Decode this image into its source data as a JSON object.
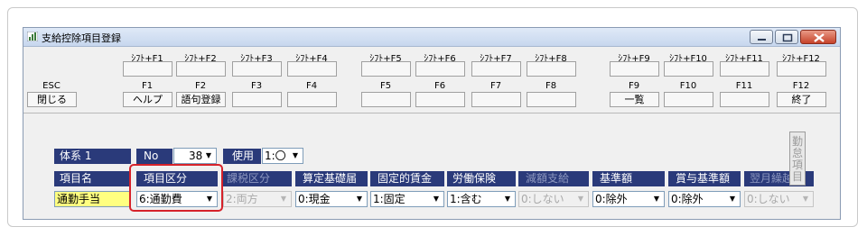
{
  "window": {
    "title": "支給控除項目登録",
    "icon": "bar-chart-icon",
    "controls": [
      "minimize-icon",
      "maximize-icon",
      "close-icon"
    ]
  },
  "fkeys": [
    {
      "shift": "",
      "key": "ESC",
      "label": "閉じる"
    },
    {
      "shift": "ｼﾌﾄ+F1",
      "key": "F1",
      "label": "ヘルプ"
    },
    {
      "shift": "ｼﾌﾄ+F2",
      "key": "F2",
      "label": "語句登録"
    },
    {
      "shift": "ｼﾌﾄ+F3",
      "key": "F3",
      "label": ""
    },
    {
      "shift": "ｼﾌﾄ+F4",
      "key": "F4",
      "label": ""
    },
    {
      "shift": "ｼﾌﾄ+F5",
      "key": "F5",
      "label": ""
    },
    {
      "shift": "ｼﾌﾄ+F6",
      "key": "F6",
      "label": ""
    },
    {
      "shift": "ｼﾌﾄ+F7",
      "key": "F7",
      "label": ""
    },
    {
      "shift": "ｼﾌﾄ+F8",
      "key": "F8",
      "label": ""
    },
    {
      "shift": "ｼﾌﾄ+F9",
      "key": "F9",
      "label": "一覧"
    },
    {
      "shift": "ｼﾌﾄ+F10",
      "key": "F10",
      "label": ""
    },
    {
      "shift": "ｼﾌﾄ+F11",
      "key": "F11",
      "label": ""
    },
    {
      "shift": "ｼﾌﾄ+F12",
      "key": "F12",
      "label": "終了"
    }
  ],
  "form": {
    "taikei_label": "体系 1",
    "no_label": "No",
    "no_value": "38",
    "shiyou_label": "使用",
    "shiyou_value": "1:〇",
    "side_label": "勤怠項目"
  },
  "columns": [
    {
      "header": "項目名",
      "value": "通勤手当",
      "enabled": true
    },
    {
      "header": "項目区分",
      "value": "6:通勤費",
      "enabled": true
    },
    {
      "header": "課税区分",
      "value": "2:両方",
      "enabled": false
    },
    {
      "header": "算定基礎届",
      "value": "0:現金",
      "enabled": true
    },
    {
      "header": "固定的賃金",
      "value": "1:固定",
      "enabled": true
    },
    {
      "header": "労働保険",
      "value": "1:含む",
      "enabled": true
    },
    {
      "header": "減額支給",
      "value": "0:しない",
      "enabled": false
    },
    {
      "header": "基準額",
      "value": "0:除外",
      "enabled": true
    },
    {
      "header": "賞与基準額",
      "value": "0:除外",
      "enabled": true
    },
    {
      "header": "翌月繰越",
      "value": "0:しない",
      "enabled": false
    }
  ],
  "colors": {
    "header_navy": "#2a3a7a",
    "name_field": "#ffff80",
    "highlight": "#d6222a"
  }
}
